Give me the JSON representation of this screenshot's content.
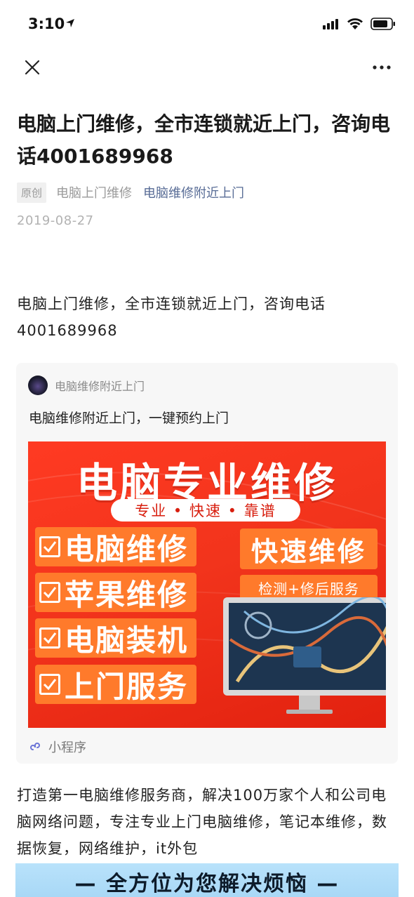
{
  "status_bar": {
    "time": "3:10"
  },
  "article": {
    "title": "电脑上门维修，全市连锁就近上门，咨询电话4001689968",
    "original_tag": "原创",
    "author": "电脑上门维修",
    "account": "电脑维修附近上门",
    "date": "2019-08-27",
    "lead": "电脑上门维修，全市连锁就近上门，咨询电话4001689968",
    "body": "打造第一电脑维修服务商，解决100万家个人和公司电脑网络问题，专注专业上门电脑维修，笔记本维修，数据恢复，网络维护，it外包"
  },
  "mini_program_card": {
    "name": "电脑维修附近上门",
    "description": "电脑维修附近上门，一键预约上门",
    "footer_label": "小程序",
    "poster": {
      "heading": "电脑专业维修",
      "tagline": "专业 • 快速 • 靠谱",
      "checklist": [
        "电脑维修",
        "苹果维修",
        "电脑装机",
        "上门服务"
      ],
      "fast_title": "快速维修",
      "fast_subtitle": "检测+修后服务"
    }
  },
  "banner": {
    "text": "— 全方位为您解决烦恼 —"
  },
  "colors": {
    "link": "#576b95",
    "poster_red": "#f2341c",
    "poster_orange": "#ff7a2b",
    "banner_blue": "#b9e2fb"
  }
}
